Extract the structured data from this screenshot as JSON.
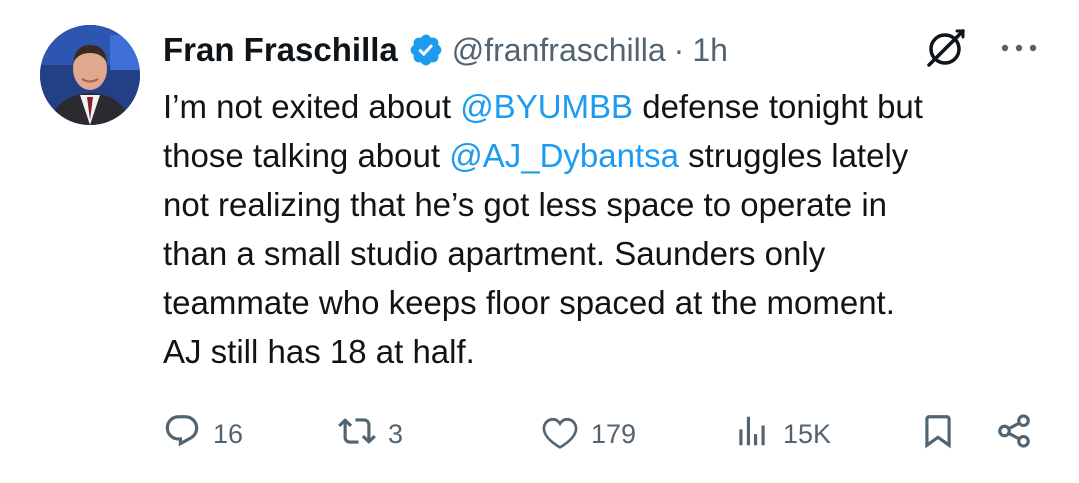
{
  "author": {
    "display_name": "Fran Fraschilla",
    "handle": "@franfraschilla",
    "separator": "·",
    "time": "1h"
  },
  "tweet": {
    "segments": [
      {
        "text": "I’m not exited about ",
        "type": "text"
      },
      {
        "text": "@BYUMBB",
        "type": "mention"
      },
      {
        "text": " defense tonight but\nthose talking about ",
        "type": "text"
      },
      {
        "text": "@AJ_Dybantsa",
        "type": "mention"
      },
      {
        "text": " struggles lately\nnot realizing that he’s got less space to operate in\nthan a small studio apartment. Saunders only\nteammate who keeps floor spaced at the moment.\nAJ still has 18 at half.",
        "type": "text"
      }
    ]
  },
  "actions": {
    "replies": "16",
    "retweets": "3",
    "likes": "179",
    "views": "15K"
  },
  "icons": {
    "verified": "verified-badge-icon",
    "grok": "grok-icon",
    "more": "more-dots-icon",
    "reply": "reply-icon",
    "retweet": "retweet-icon",
    "like": "heart-icon",
    "views": "views-icon",
    "bookmark": "bookmark-icon",
    "share": "share-icon"
  },
  "colors": {
    "text": "#0f1419",
    "secondary": "#536471",
    "accent": "#1d9bf0"
  }
}
